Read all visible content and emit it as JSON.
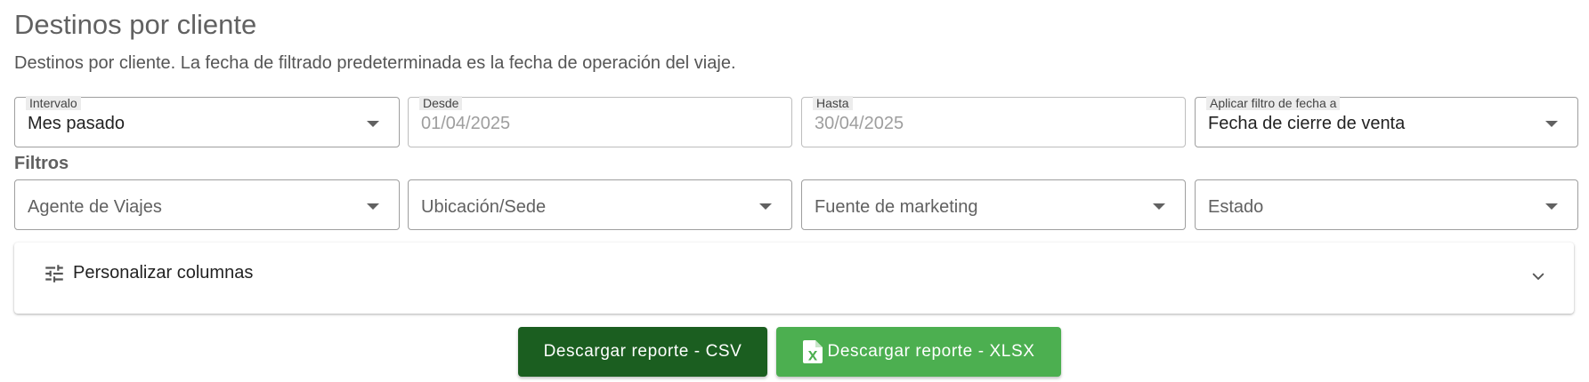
{
  "page": {
    "title": "Destinos por cliente",
    "description": "Destinos por cliente. La fecha de filtrado predeterminada es la fecha de operación del viaje."
  },
  "date_filters": {
    "interval": {
      "label": "Intervalo",
      "value": "Mes pasado"
    },
    "from": {
      "label": "Desde",
      "value": "01/04/2025"
    },
    "to": {
      "label": "Hasta",
      "value": "30/04/2025"
    },
    "apply_to": {
      "label": "Aplicar filtro de fecha a",
      "value": "Fecha de cierre de venta"
    }
  },
  "filters": {
    "section_label": "Filtros",
    "travel_agent": {
      "placeholder": "Agente de Viajes"
    },
    "location": {
      "placeholder": "Ubicación/Sede"
    },
    "marketing_source": {
      "placeholder": "Fuente de marketing"
    },
    "status": {
      "placeholder": "Estado"
    }
  },
  "columns_panel": {
    "label": "Personalizar columnas",
    "icon": "tune-icon",
    "expanded": false
  },
  "actions": {
    "download_csv": "Descargar reporte - CSV",
    "download_xlsx": "Descargar reporte - XLSX"
  },
  "colors": {
    "csv_button": "#1b5e20",
    "xlsx_button": "#4caf50",
    "title_text": "#616161"
  }
}
